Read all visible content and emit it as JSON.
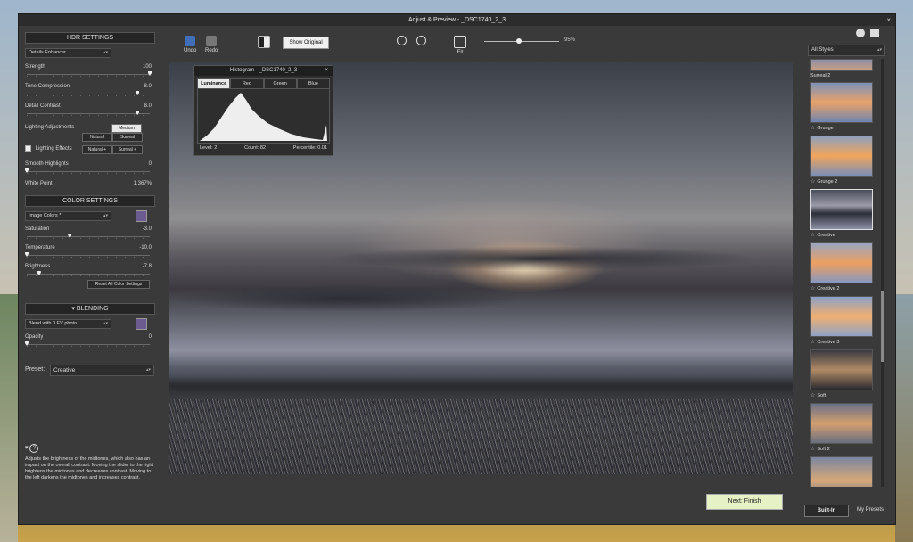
{
  "window": {
    "title": "Adjust & Preview - _DSC1740_2_3",
    "close": "×"
  },
  "hdr": {
    "header": "HDR SETTINGS",
    "method": "Details Enhancer",
    "strength": {
      "label": "Strength",
      "value": "100",
      "level": 1.0
    },
    "tone": {
      "label": "Tone Compression",
      "value": "8.0",
      "level": 0.9
    },
    "detail": {
      "label": "Detail Contrast",
      "value": "8.0",
      "level": 0.9
    },
    "lighting_label": "Lighting Adjustments",
    "lighting_mode": "Medium",
    "natural": "Natural",
    "surreal": "Surreal",
    "lighting_effects": "Lighting Effects",
    "natural_plus": "Natural +",
    "surreal_plus": "Surreal +",
    "smooth": {
      "label": "Smooth Highlights",
      "value": "0",
      "level": 0.0
    },
    "white": {
      "label": "White Point",
      "value": "1.367%"
    }
  },
  "color": {
    "header": "COLOR SETTINGS",
    "preset": "Image Colors *",
    "saturation": {
      "label": "Saturation",
      "value": "-3.0",
      "level": 0.35
    },
    "temperature": {
      "label": "Temperature",
      "value": "-10.0",
      "level": 0.0
    },
    "brightness": {
      "label": "Brightness",
      "value": "-7.8",
      "level": 0.1
    },
    "reset": "Reset All Color Settings"
  },
  "blending": {
    "header": "BLENDING",
    "mode": "Blend with 0 EV photo",
    "opacity": {
      "label": "Opacity",
      "value": "0",
      "level": 0.0
    }
  },
  "preset": {
    "label": "Preset:",
    "value": "Creative"
  },
  "help": {
    "text": "Adjusts the brightness of the midtones, which also has an impact on the overall contrast. Moving the slider to the right brightens the midtones and decreases contrast. Moving to the left darkens the midtones and increases contrast."
  },
  "toolbar": {
    "undo": "Undo",
    "redo": "Redo",
    "show_original": "Show Original",
    "fit": "Fit",
    "zoom": "95%"
  },
  "histogram": {
    "title": "Histogram - _DSC1740_2_3",
    "tabs": [
      "Luminance",
      "Red",
      "Green",
      "Blue"
    ],
    "level": "Level: 2",
    "count": "Count: 82",
    "percentile": "Percentile: 0.01"
  },
  "next_button": "Next: Finish",
  "styles": {
    "filter": "All Styles",
    "items": [
      "Surreal 2",
      "Grunge",
      "Grunge 2",
      "Creative",
      "Creative 2",
      "Creative 3",
      "Soft",
      "Soft 2",
      ""
    ],
    "built_in": "Built-In",
    "my_presets": "My Presets"
  },
  "colors": {
    "accent_next": "#e6f2c6",
    "panel": "#3a3a3a",
    "dark": "#252525"
  }
}
